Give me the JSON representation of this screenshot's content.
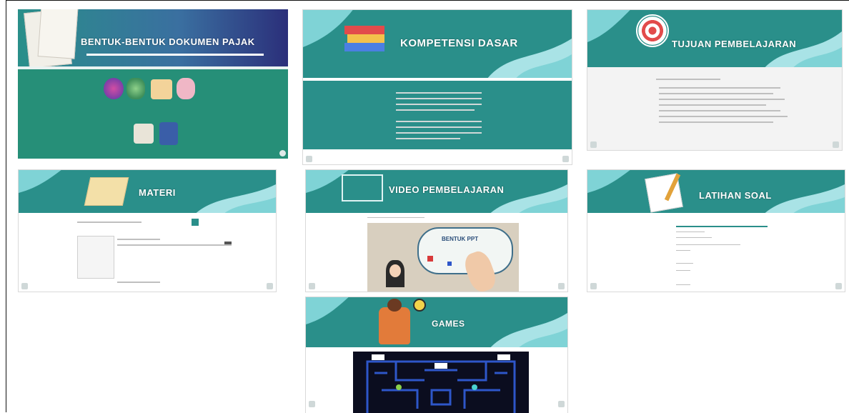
{
  "slides": [
    {
      "title": "BENTUK-BENTUK DOKUMEN PAJAK"
    },
    {
      "title": "KOMPETENSI DASAR"
    },
    {
      "title": "TUJUAN PEMBELAJARAN"
    },
    {
      "title": "MATERI"
    },
    {
      "title": "VIDEO PEMBELAJARAN",
      "video_overlay_text": "BENTUK PPT"
    },
    {
      "title": "LATIHAN SOAL"
    },
    {
      "title": "GAMES"
    }
  ],
  "colors": {
    "teal": "#2a8f8a",
    "light_teal": "#7fd3d6",
    "sky": "#a9e3e6",
    "navy_purple": "#2b2f7a",
    "game_bg": "#0b0d1f",
    "maze_blue": "#2e56c9"
  }
}
